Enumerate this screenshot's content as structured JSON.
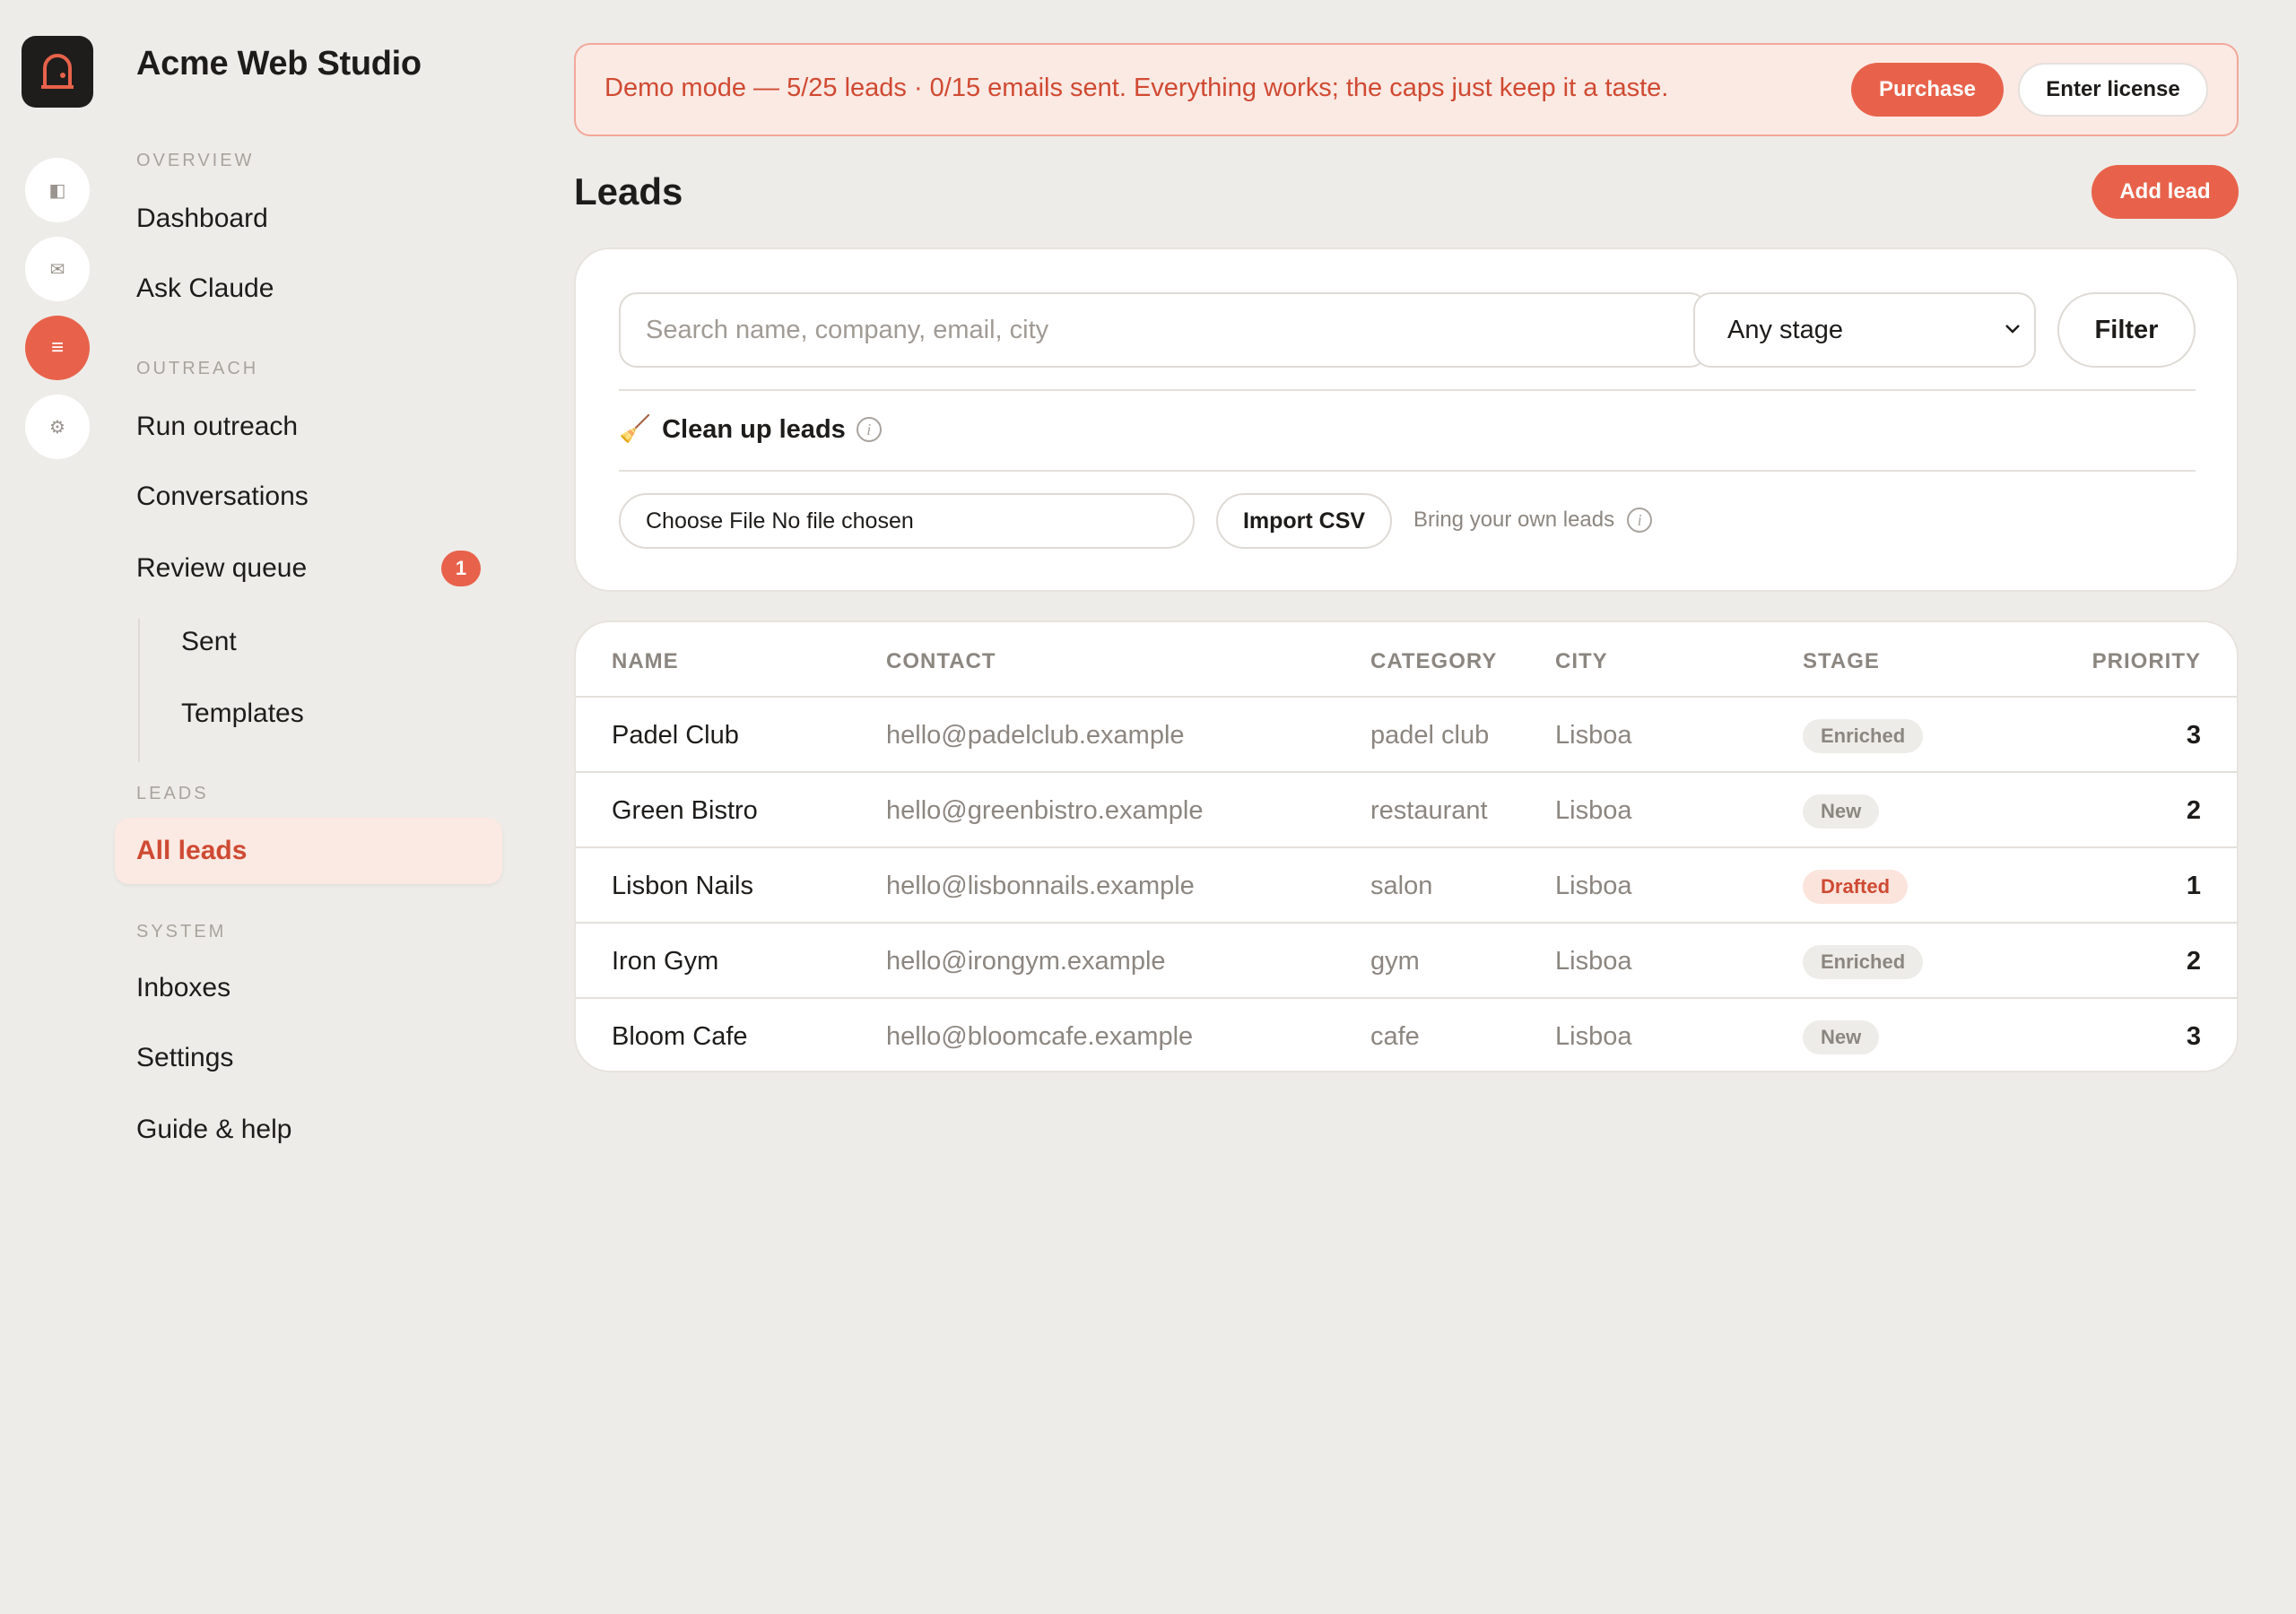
{
  "app": {
    "name": "Acme Web Studio"
  },
  "sidebar": {
    "sections": {
      "overview": "OVERVIEW",
      "outreach": "OUTREACH",
      "leads": "LEADS",
      "system": "SYSTEM"
    },
    "items": {
      "dashboard": "Dashboard",
      "ask_claude": "Ask Claude",
      "run_outreach": "Run outreach",
      "conversations": "Conversations",
      "review_queue": "Review queue",
      "review_queue_badge": "1",
      "sent": "Sent",
      "templates": "Templates",
      "all_leads": "All leads",
      "inboxes": "Inboxes",
      "settings": "Settings",
      "guide": "Guide & help"
    },
    "rail_icons": [
      "panel-icon",
      "mail-icon",
      "list-icon",
      "gear-icon"
    ]
  },
  "banner": {
    "text": "Demo mode — 5/25 leads · 0/15 emails sent. Everything works; the caps just keep it a taste.",
    "purchase_label": "Purchase",
    "license_label": "Enter license"
  },
  "page": {
    "title": "Leads",
    "add_label": "Add lead"
  },
  "filters": {
    "search_placeholder": "Search name, company, email, city",
    "stage_value": "Any stage",
    "filter_label": "Filter",
    "cleanup_label": "Clean up leads",
    "file_label": "Choose File No file chosen",
    "import_label": "Import CSV",
    "byo_label": "Bring your own leads"
  },
  "table": {
    "headers": [
      "NAME",
      "CONTACT",
      "CATEGORY",
      "CITY",
      "STAGE",
      "PRIORITY"
    ],
    "rows": [
      {
        "name": "Padel Club",
        "contact": "hello@padelclub.example",
        "category": "padel club",
        "city": "Lisboa",
        "stage": "Enriched",
        "priority": "3"
      },
      {
        "name": "Green Bistro",
        "contact": "hello@greenbistro.example",
        "category": "restaurant",
        "city": "Lisboa",
        "stage": "New",
        "priority": "2"
      },
      {
        "name": "Lisbon Nails",
        "contact": "hello@lisbonnails.example",
        "category": "salon",
        "city": "Lisboa",
        "stage": "Drafted",
        "priority": "1"
      },
      {
        "name": "Iron Gym",
        "contact": "hello@irongym.example",
        "category": "gym",
        "city": "Lisboa",
        "stage": "Enriched",
        "priority": "2"
      },
      {
        "name": "Bloom Cafe",
        "contact": "hello@bloomcafe.example",
        "category": "cafe",
        "city": "Lisboa",
        "stage": "New",
        "priority": "3"
      }
    ]
  },
  "colors": {
    "accent": "#e8624b",
    "background": "#eeece8",
    "banner_bg": "#fbe9e4",
    "banner_text": "#d04a32"
  }
}
